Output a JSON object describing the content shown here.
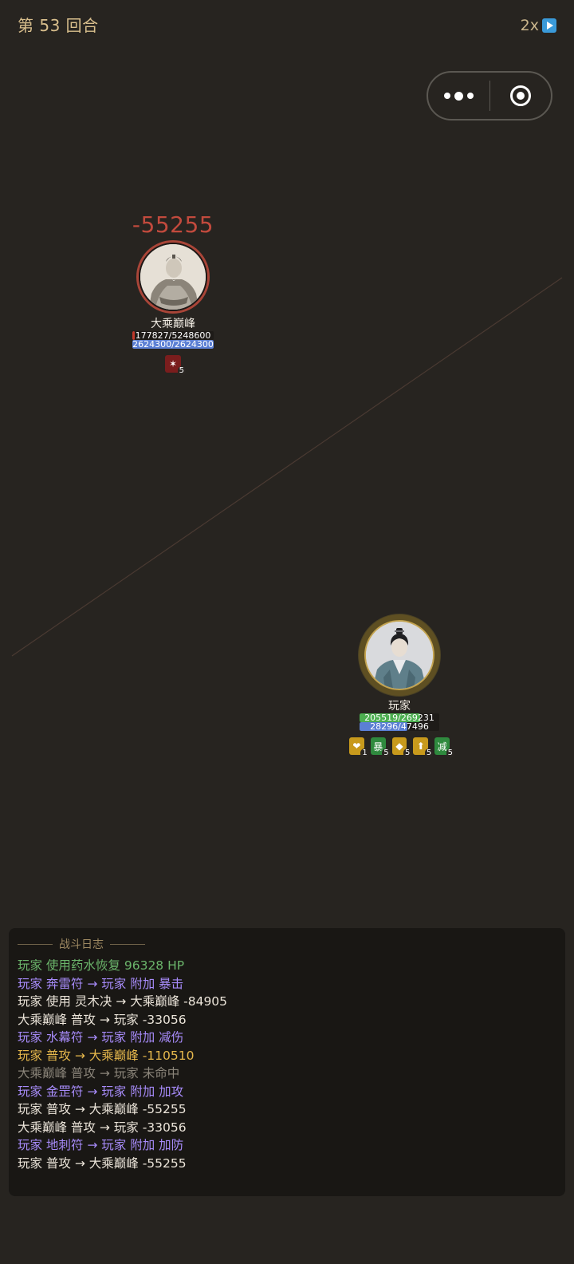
{
  "header": {
    "round_label": "第 53 回合",
    "speed_label": "2x",
    "speed_icon": "play-icon"
  },
  "enemy": {
    "damage_popup": "-55255",
    "name": "大乘巅峰",
    "hp_text": "177827/5248600",
    "hp_fraction": 0.034,
    "mp_text": "2624300/2624300",
    "mp_fraction": 1.0,
    "status_effects": [
      {
        "icon": "bleed-icon",
        "glyph": "✶",
        "stacks": "5",
        "color": "#7a1d1d"
      }
    ]
  },
  "player": {
    "name": "玩家",
    "hp_text": "205519/269231",
    "hp_fraction": 0.763,
    "mp_text": "28296/47496",
    "mp_fraction": 0.596,
    "status_effects": [
      {
        "icon": "heal-icon",
        "glyph": "❤",
        "stacks": "1",
        "color": "#c89a1c"
      },
      {
        "icon": "crit-buff-icon",
        "glyph": "暴",
        "stacks": "5",
        "color": "#2f8a3e"
      },
      {
        "icon": "shield-icon",
        "glyph": "◆",
        "stacks": "5",
        "color": "#c89a1c"
      },
      {
        "icon": "attack-up-icon",
        "glyph": "⬆",
        "stacks": "5",
        "color": "#c89a1c"
      },
      {
        "icon": "damage-reduction-icon",
        "glyph": "减",
        "stacks": "5",
        "color": "#2f8a3e"
      }
    ]
  },
  "battle_log": {
    "title": "战斗日志",
    "entries": [
      {
        "text": "玩家 使用药水恢复 96328 HP",
        "color": "#6bb56b"
      },
      {
        "text": "玩家 奔雷符 → 玩家 附加 暴击",
        "color": "#a78bfa"
      },
      {
        "text": "玩家 使用 灵木决 → 大乘巅峰 -84905",
        "color": "#ece5da"
      },
      {
        "text": "大乘巅峰 普攻 → 玩家 -33056",
        "color": "#ece5da"
      },
      {
        "text": "玩家 水幕符 → 玩家 附加 减伤",
        "color": "#a78bfa"
      },
      {
        "text": "玩家 普攻 → 大乘巅峰 -110510",
        "color": "#e6b84c"
      },
      {
        "text": "大乘巅峰 普攻 → 玩家 未命中",
        "color": "#8b857a"
      },
      {
        "text": "玩家 金罡符 → 玩家 附加 加攻",
        "color": "#a78bfa"
      },
      {
        "text": "玩家 普攻 → 大乘巅峰 -55255",
        "color": "#ece5da"
      },
      {
        "text": "大乘巅峰 普攻 → 玩家 -33056",
        "color": "#ece5da"
      },
      {
        "text": "玩家 地刺符 → 玩家 附加 加防",
        "color": "#a78bfa"
      },
      {
        "text": "玩家 普攻 → 大乘巅峰 -55255",
        "color": "#ece5da"
      }
    ]
  },
  "colors": {
    "background": "#272420",
    "accent_gold": "#d9bf8d",
    "hp_green": "#4caf50",
    "hp_red": "#c0392b",
    "mp_blue": "#5b7fd4",
    "damage_red": "#c24a3d"
  }
}
